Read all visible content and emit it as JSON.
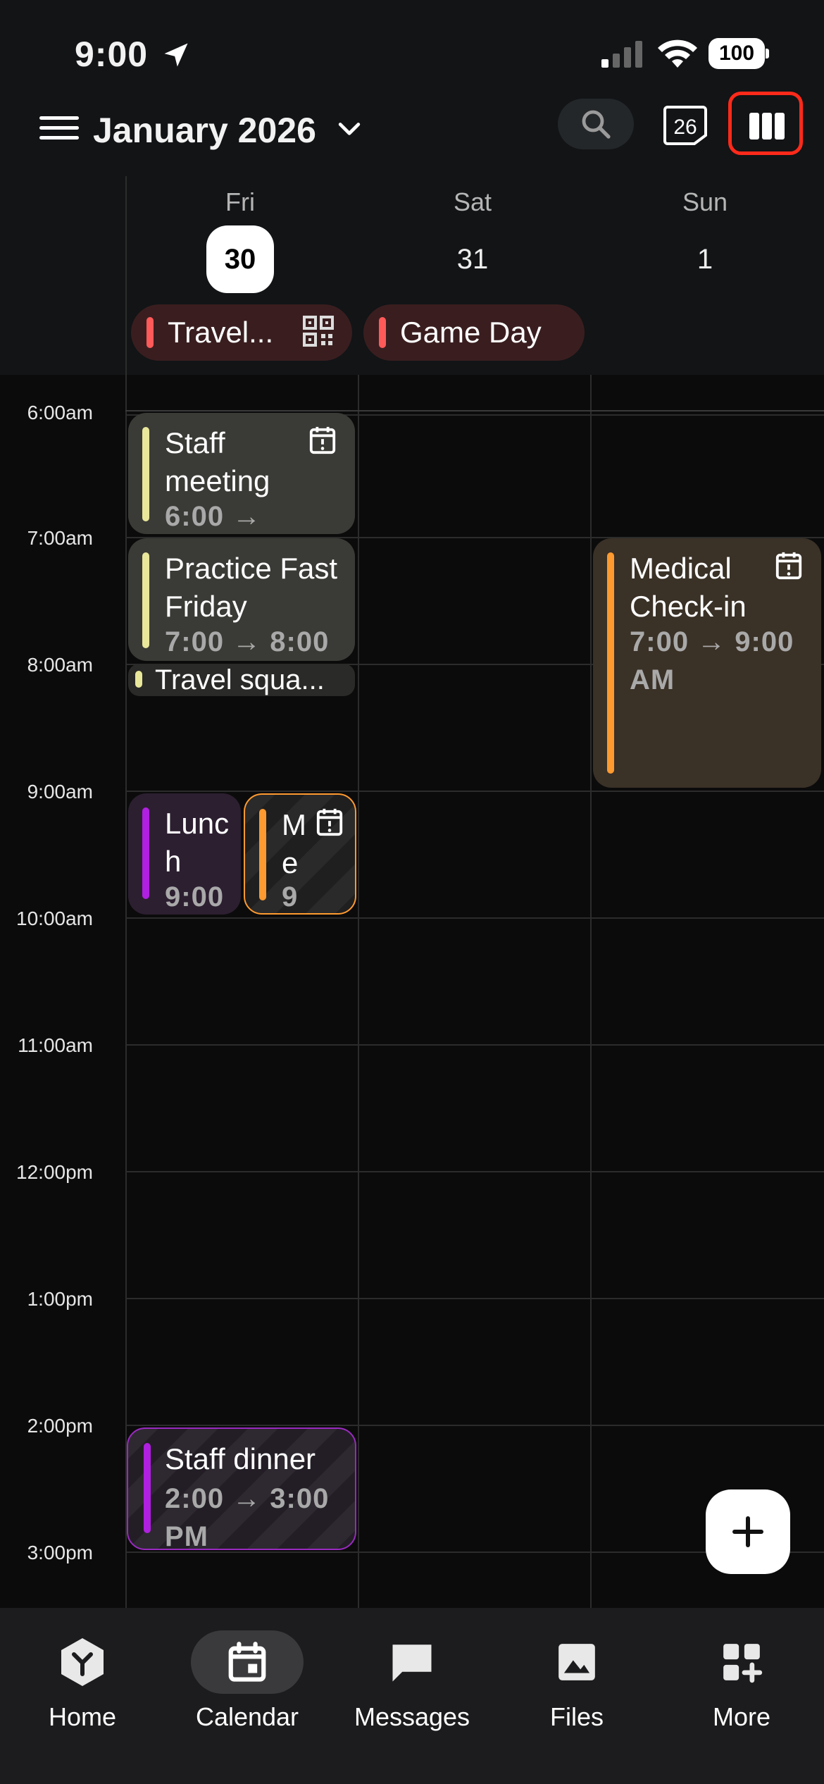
{
  "status_bar": {
    "time": "9:00",
    "battery": "100"
  },
  "header": {
    "month_title": "January 2026",
    "today_badge": "26"
  },
  "days": [
    {
      "name": "Fri",
      "number": "30",
      "today": true
    },
    {
      "name": "Sat",
      "number": "31",
      "today": false
    },
    {
      "name": "Sun",
      "number": "1",
      "today": false
    }
  ],
  "all_day_events": [
    {
      "title": "Travel...",
      "color": "#ff5a5a"
    },
    {
      "title": "Game Day",
      "color": "#ff5a5a"
    }
  ],
  "time_labels": [
    "6:00am",
    "7:00am",
    "8:00am",
    "9:00am",
    "10:00am",
    "11:00am",
    "12:00pm",
    "1:00pm",
    "2:00pm",
    "3:00pm"
  ],
  "events": {
    "staff_meeting": {
      "title": "Staff meeting",
      "time": "6:00 →",
      "color": "#e9e79a"
    },
    "practice_fast_friday": {
      "title": "Practice Fast Friday",
      "time": "7:00 → 8:00",
      "color": "#e9e79a"
    },
    "travel_squad": {
      "title": "Travel squa...",
      "color": "#e9e79a"
    },
    "lunch": {
      "title": "Lunch",
      "time": "9:00",
      "color": "#b020e0"
    },
    "me_event": {
      "title": "Me",
      "time": "9",
      "color": "#ff9a30"
    },
    "medical_checkin": {
      "title": "Medical Check-in",
      "time": "7:00 → 9:00 AM",
      "color": "#ff9a30"
    },
    "staff_dinner": {
      "title": "Staff dinner",
      "time": "2:00 → 3:00 PM",
      "color": "#b020e0"
    }
  },
  "bottom_nav": [
    {
      "label": "Home",
      "icon": "home-icon"
    },
    {
      "label": "Calendar",
      "icon": "calendar-icon",
      "active": true
    },
    {
      "label": "Messages",
      "icon": "messages-icon"
    },
    {
      "label": "Files",
      "icon": "files-icon"
    },
    {
      "label": "More",
      "icon": "more-icon"
    }
  ]
}
